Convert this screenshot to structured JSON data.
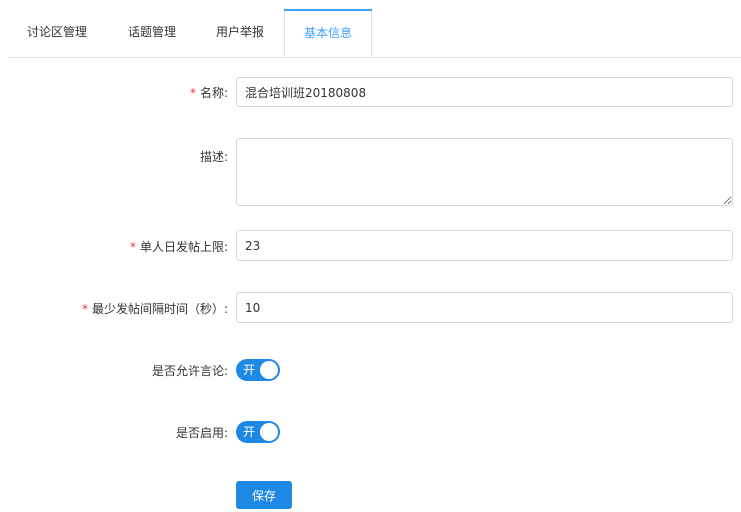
{
  "tabs": [
    {
      "label": "讨论区管理",
      "active": false
    },
    {
      "label": "话题管理",
      "active": false
    },
    {
      "label": "用户举报",
      "active": false
    },
    {
      "label": "基本信息",
      "active": true
    }
  ],
  "form": {
    "required_mark": "*",
    "name": {
      "label": "名称:",
      "value": "混合培训班20180808"
    },
    "description": {
      "label": "描述:",
      "value": ""
    },
    "daily_limit": {
      "label": "单人日发帖上限:",
      "value": "23"
    },
    "min_interval": {
      "label": "最少发帖间隔时间（秒）:",
      "value": "10"
    },
    "allow_comment": {
      "label": "是否允许言论:",
      "state_text": "开",
      "on": true
    },
    "enabled": {
      "label": "是否启用:",
      "state_text": "开",
      "on": true
    },
    "save_label": "保存"
  },
  "colors": {
    "accent": "#409eff",
    "primary_button": "#1e88e5",
    "required": "#e4393c"
  }
}
